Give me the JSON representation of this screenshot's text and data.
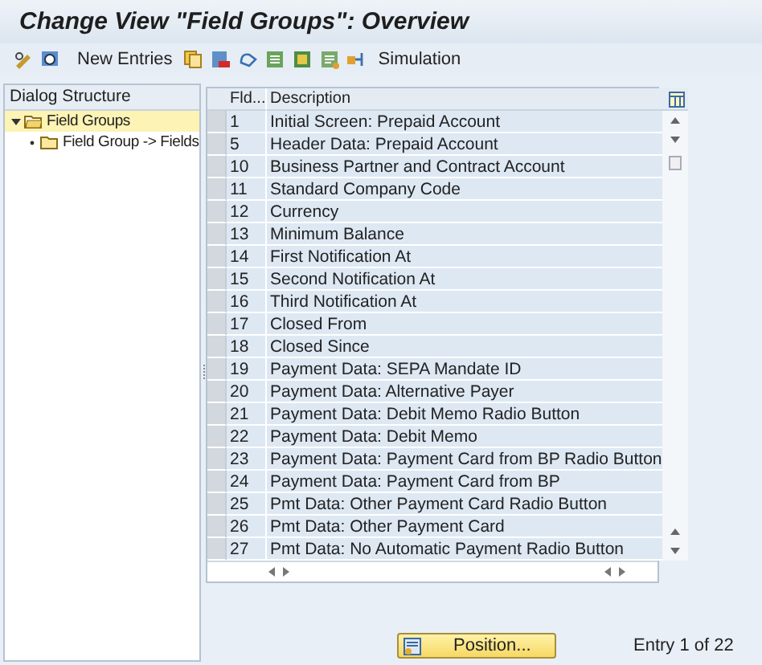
{
  "window": {
    "title": "Change View \"Field Groups\": Overview"
  },
  "toolbar": {
    "new_entries": "New Entries",
    "simulation": "Simulation"
  },
  "dialog_structure": {
    "title": "Dialog Structure",
    "items": [
      {
        "label": "Field Groups",
        "selected": true,
        "expanded": true,
        "children": [
          {
            "label": "Field Group -> Fields",
            "selected": false
          }
        ]
      }
    ]
  },
  "table": {
    "columns": [
      "Fld...",
      "Description"
    ],
    "rows": [
      {
        "cells": [
          "1",
          "Initial Screen: Prepaid Account"
        ]
      },
      {
        "cells": [
          "5",
          "Header Data: Prepaid Account"
        ]
      },
      {
        "cells": [
          "10",
          "Business Partner and Contract Account"
        ]
      },
      {
        "cells": [
          "11",
          "Standard Company Code"
        ]
      },
      {
        "cells": [
          "12",
          "Currency"
        ]
      },
      {
        "cells": [
          "13",
          "Minimum Balance"
        ]
      },
      {
        "cells": [
          "14",
          "First Notification At"
        ]
      },
      {
        "cells": [
          "15",
          "Second Notification At"
        ]
      },
      {
        "cells": [
          "16",
          "Third Notification At"
        ]
      },
      {
        "cells": [
          "17",
          "Closed From"
        ]
      },
      {
        "cells": [
          "18",
          "Closed Since"
        ]
      },
      {
        "cells": [
          "19",
          "Payment Data: SEPA Mandate ID"
        ]
      },
      {
        "cells": [
          "20",
          "Payment Data: Alternative Payer"
        ]
      },
      {
        "cells": [
          "21",
          "Payment Data: Debit Memo Radio Button"
        ]
      },
      {
        "cells": [
          "22",
          "Payment Data: Debit Memo"
        ]
      },
      {
        "cells": [
          "23",
          "Payment Data: Payment Card from BP Radio Button"
        ]
      },
      {
        "cells": [
          "24",
          "Payment Data: Payment Card from BP"
        ]
      },
      {
        "cells": [
          "25",
          "Pmt Data: Other Payment Card Radio Button"
        ]
      },
      {
        "cells": [
          "26",
          "Pmt Data: Other Payment Card"
        ]
      },
      {
        "cells": [
          "27",
          "Pmt Data: No Automatic Payment Radio Button"
        ]
      }
    ]
  },
  "footer": {
    "position_button": "Position...",
    "entry_info": "Entry 1 of 22"
  }
}
